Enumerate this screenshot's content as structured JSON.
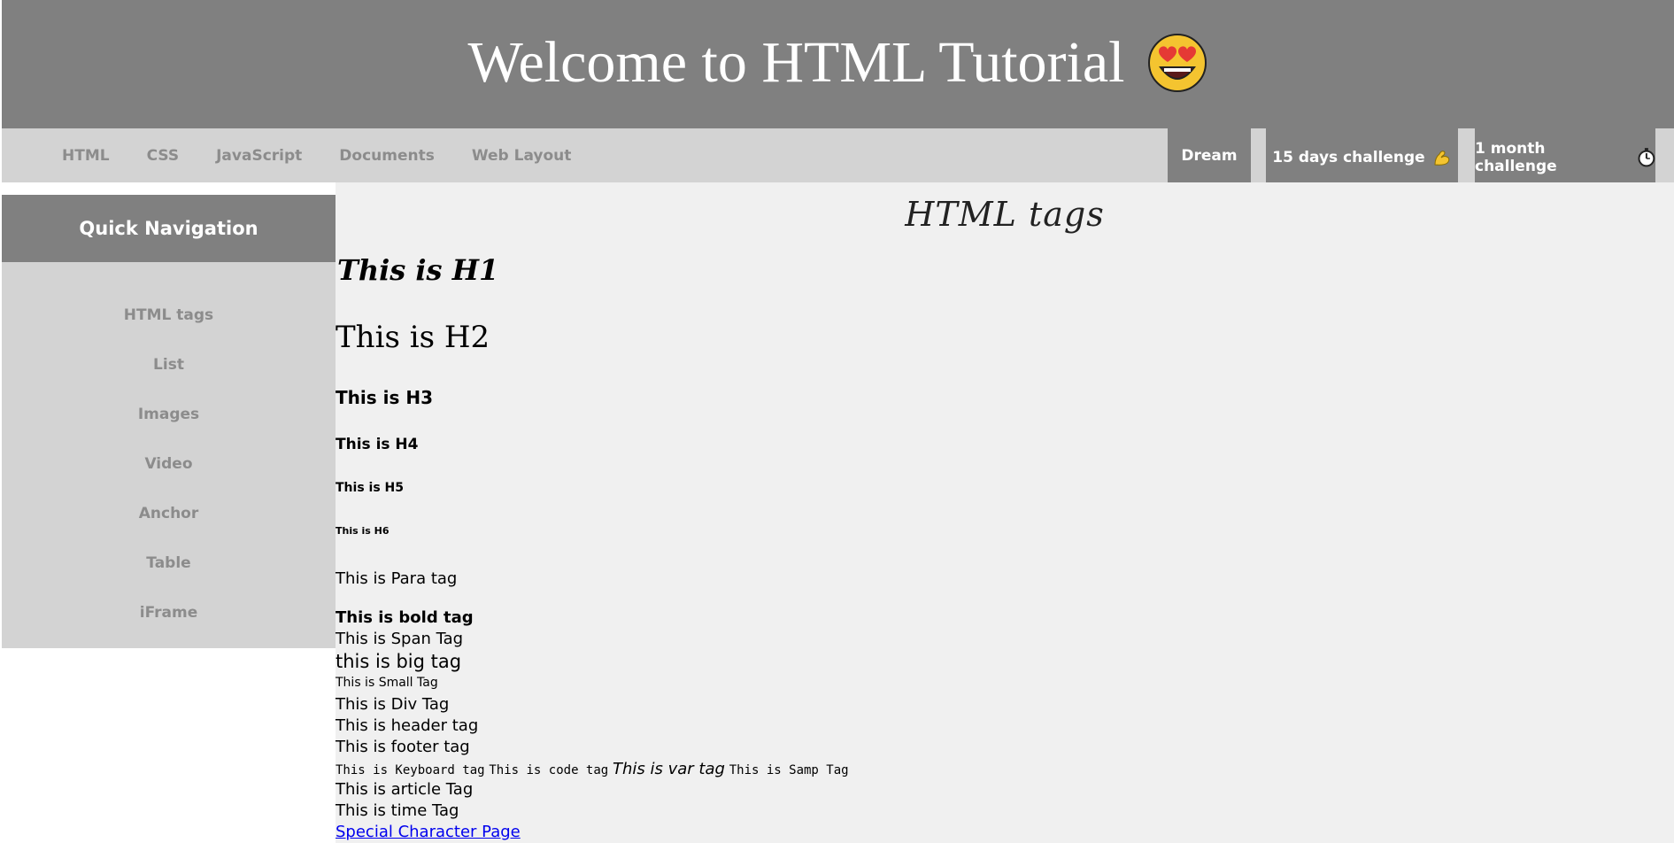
{
  "header": {
    "title": "Welcome to HTML Tutorial",
    "emoji": "heart-eyes-emoji"
  },
  "nav": {
    "links": [
      "HTML",
      "CSS",
      "JavaScript",
      "Documents",
      "Web Layout"
    ],
    "right": {
      "dream": "Dream",
      "challenge15": "15 days challenge",
      "challenge15_icon": "flexed-biceps-emoji",
      "challenge1m": "1 month challenge",
      "challenge1m_icon": "stopwatch-emoji"
    }
  },
  "sidebar": {
    "heading": "Quick Navigation",
    "items": [
      "HTML tags",
      "List",
      "Images",
      "Video",
      "Anchor",
      "Table",
      "iFrame"
    ]
  },
  "main": {
    "title": "HTML tags",
    "h1": "This is H1",
    "h2": "This is H2",
    "h3": "This is H3",
    "h4": "This is H4",
    "h5": "This is H5",
    "h6": "This is H6",
    "para": "This is Para tag",
    "bold": "This is bold tag",
    "span": "This is Span Tag",
    "big": "this is big tag",
    "small": "This is Small Tag",
    "div": "This is Div Tag",
    "header": "This is header tag",
    "footer": "This is footer tag",
    "kbd": "This is Keyboard tag",
    "code": "This is code tag",
    "var": "This is var tag",
    "samp": "This is Samp Tag",
    "article": "This is article Tag",
    "time": "This is time Tag",
    "special_link": "Special Character Page"
  },
  "colors": {
    "header_bg": "#808080",
    "nav_bg": "#d3d3d3",
    "main_bg": "#f0f0f0",
    "link": "#0000ee"
  }
}
